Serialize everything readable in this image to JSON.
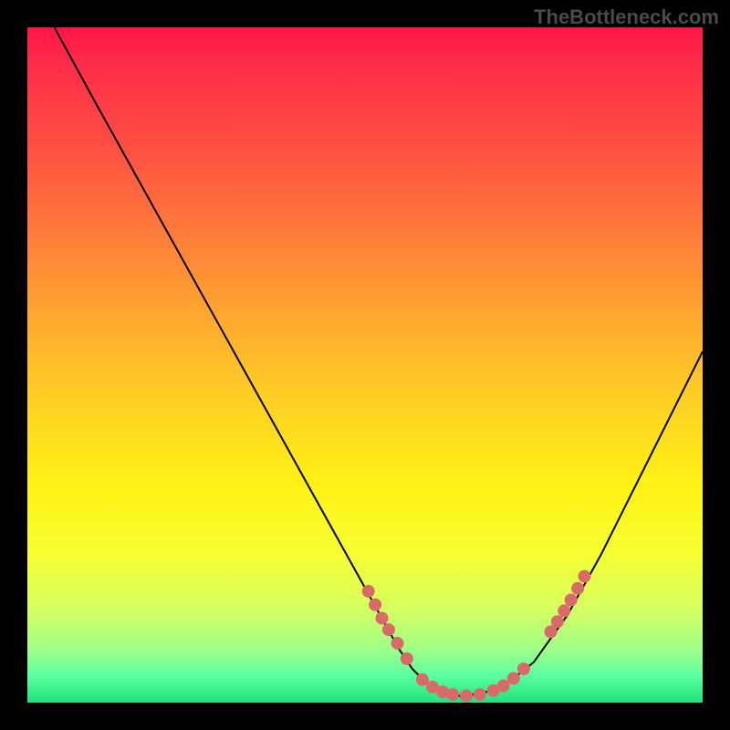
{
  "watermark": "TheBottleneck.com",
  "chart_data": {
    "type": "line",
    "title": "",
    "xlabel": "",
    "ylabel": "",
    "xlim": [
      0,
      100
    ],
    "ylim": [
      0,
      100
    ],
    "grid": false,
    "legend": false,
    "series": [
      {
        "name": "curve",
        "x": [
          4,
          10,
          15,
          20,
          25,
          30,
          35,
          40,
          45,
          50,
          55,
          57,
          59,
          61,
          63,
          65,
          70,
          75,
          80,
          85,
          90,
          95,
          100
        ],
        "y": [
          100,
          89,
          80,
          71,
          62,
          53,
          44,
          35,
          26,
          17,
          8,
          5,
          3,
          2,
          1,
          1,
          2,
          6,
          13,
          22,
          32,
          42,
          52
        ]
      }
    ],
    "highlight_points": {
      "left_segment": [
        {
          "x": 50.5,
          "y": 16.5
        },
        {
          "x": 51.5,
          "y": 14.5
        },
        {
          "x": 52.5,
          "y": 12.5
        },
        {
          "x": 53.5,
          "y": 10.8
        },
        {
          "x": 54.8,
          "y": 8.8
        },
        {
          "x": 56.2,
          "y": 6.5
        }
      ],
      "bottom_segment": [
        {
          "x": 58.5,
          "y": 3.4
        },
        {
          "x": 60.0,
          "y": 2.3
        },
        {
          "x": 61.5,
          "y": 1.6
        },
        {
          "x": 63.0,
          "y": 1.2
        },
        {
          "x": 65.0,
          "y": 1.0
        },
        {
          "x": 67.0,
          "y": 1.2
        },
        {
          "x": 69.0,
          "y": 1.8
        },
        {
          "x": 70.5,
          "y": 2.5
        },
        {
          "x": 72.0,
          "y": 3.6
        },
        {
          "x": 73.5,
          "y": 5.0
        }
      ],
      "right_segment": [
        {
          "x": 77.5,
          "y": 10.5
        },
        {
          "x": 78.5,
          "y": 12.0
        },
        {
          "x": 79.5,
          "y": 13.6
        },
        {
          "x": 80.5,
          "y": 15.2
        },
        {
          "x": 81.5,
          "y": 16.9
        },
        {
          "x": 82.5,
          "y": 18.7
        }
      ]
    }
  }
}
